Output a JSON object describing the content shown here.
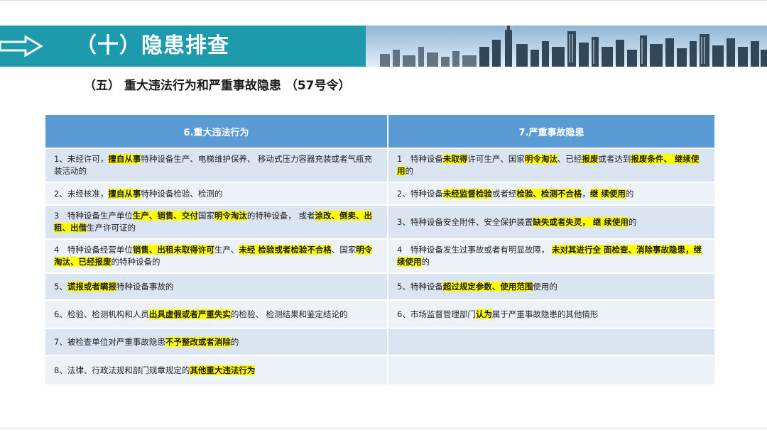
{
  "banner": {
    "title": "（十）隐患排查"
  },
  "subtitle": "（五） 重大违法行为和严重事故隐患 （57号令）",
  "table": {
    "headers": [
      "6.重大违法行为",
      "7.严重事故隐患"
    ],
    "rows": [
      [
        [
          [
            "1、未经许可，",
            0
          ],
          [
            "擅自从事",
            1
          ],
          [
            "特种设备生产、电梯维护保养、 移动式压力容器充装或者气瓶充装活动的",
            0
          ]
        ],
        [
          [
            "1　特种设备",
            0
          ],
          [
            "未取得",
            1
          ],
          [
            "许可生产、国家",
            0
          ],
          [
            "明令淘汰",
            1
          ],
          [
            "、已经",
            0
          ],
          [
            "报废",
            1
          ],
          [
            "或者达到",
            0
          ],
          [
            "报废条件、 继续使用",
            1
          ],
          [
            "的",
            0
          ]
        ]
      ],
      [
        [
          [
            "2、未经核准，",
            0
          ],
          [
            "擅自从事",
            1
          ],
          [
            "特种设备检验、检测的",
            0
          ]
        ],
        [
          [
            "2、特种设备",
            0
          ],
          [
            "未经监督检验",
            1
          ],
          [
            "或者经",
            0
          ],
          [
            "检验、检测不合格",
            1
          ],
          [
            "，",
            0
          ],
          [
            "继 续使用",
            1
          ],
          [
            "的",
            0
          ]
        ]
      ],
      [
        [
          [
            "3　特种设备生产单位",
            0
          ],
          [
            "生产、销售、交付",
            1
          ],
          [
            "国家",
            0
          ],
          [
            "明令淘汰",
            1
          ],
          [
            "的特种设备， 或者",
            0
          ],
          [
            "涂改、倒卖、出租、出借",
            1
          ],
          [
            "生产许可证的",
            0
          ]
        ],
        [
          [
            "3、特种设备安全附件、安全保护装置",
            0
          ],
          [
            "缺失或者失灵， 继 续使用",
            1
          ],
          [
            "的",
            0
          ]
        ]
      ],
      [
        [
          [
            "4　特种设备经营单位",
            0
          ],
          [
            "销售、出租未取得许可",
            1
          ],
          [
            "生产、",
            0
          ],
          [
            "未经 检验或者检验不合格",
            1
          ],
          [
            "、国家",
            0
          ],
          [
            "明令淘汰、已经报废",
            1
          ],
          [
            "的特种设备的",
            0
          ]
        ],
        [
          [
            "4　特种设备发生过事故或者有明显故障， ",
            0
          ],
          [
            "未对其进行全 面检查、消除事故隐患，继续使用",
            1
          ],
          [
            "的",
            0
          ]
        ]
      ],
      [
        [
          [
            "5、",
            0
          ],
          [
            "谎报或者瞒报",
            1
          ],
          [
            "特种设备事故的",
            0
          ]
        ],
        [
          [
            "5、特种设备",
            0
          ],
          [
            "超过规定参数、使用范围",
            1
          ],
          [
            "使用的",
            0
          ]
        ]
      ],
      [
        [
          [
            "6、检验、检测机构和人员",
            0
          ],
          [
            "出具虚假或者严重失实",
            1
          ],
          [
            "的检验、 检测结果和鉴定结论的",
            0
          ]
        ],
        [
          [
            "6、市场监督管理部门",
            0
          ],
          [
            "认为",
            1
          ],
          [
            "属于严重事故隐患的其他情形",
            0
          ]
        ]
      ],
      [
        [
          [
            "7、被检查单位对严重事故隐患",
            0
          ],
          [
            "不予整改或者消除",
            1
          ],
          [
            "的",
            0
          ]
        ],
        []
      ],
      [
        [
          [
            "8、法律、行政法规和部门规章规定的",
            0
          ],
          [
            "其他重大违法行为",
            1
          ]
        ],
        []
      ]
    ]
  }
}
